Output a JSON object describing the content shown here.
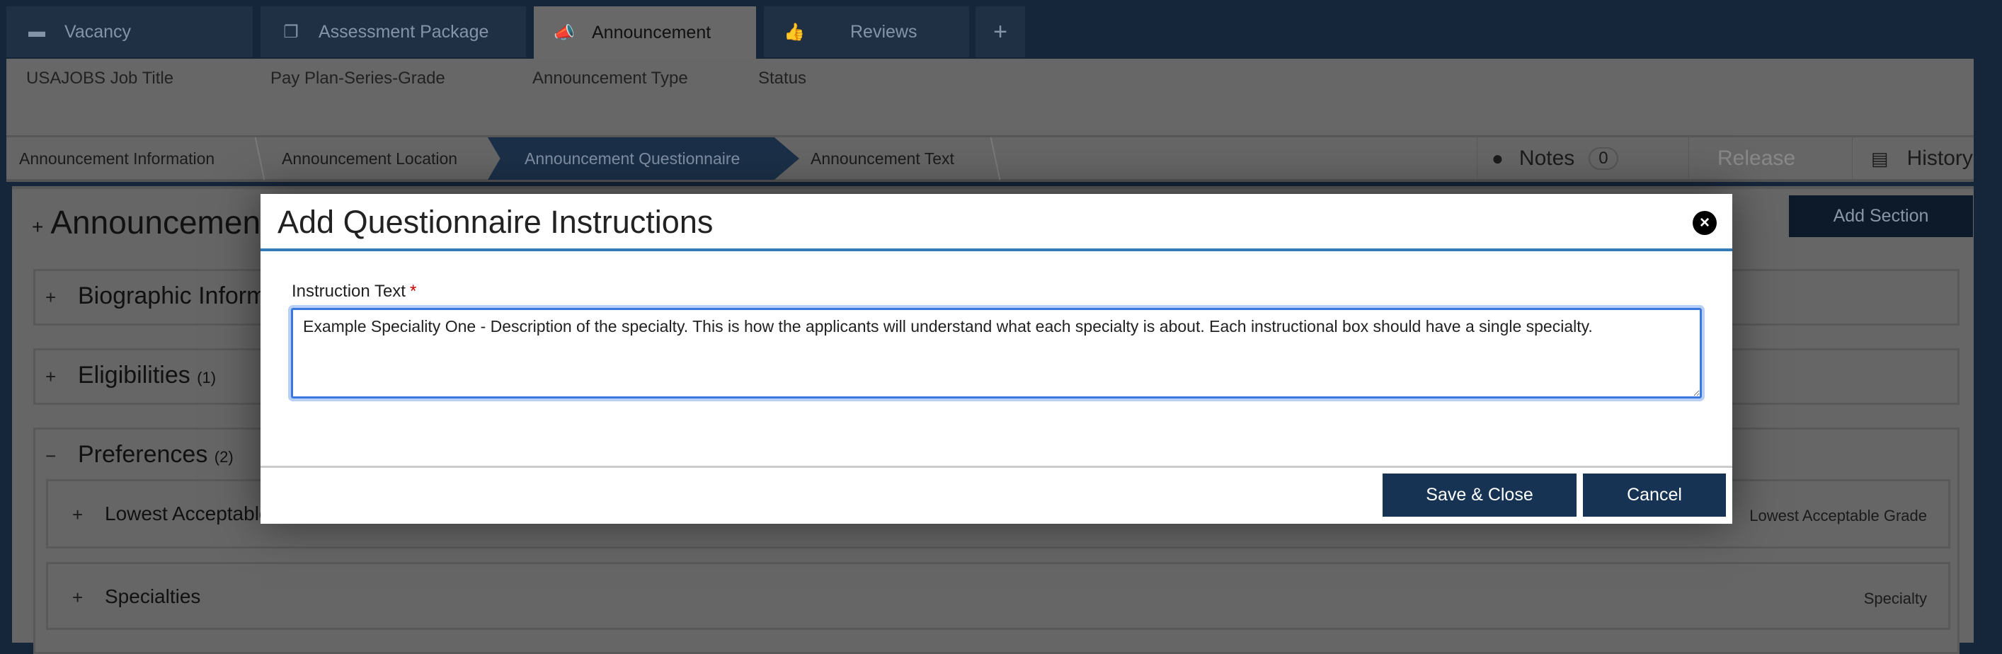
{
  "tabs": [
    {
      "label": "Vacancy",
      "icon": "folder-icon"
    },
    {
      "label": "Assessment Package",
      "icon": "copy-icon"
    },
    {
      "label": "Announcement",
      "icon": "bullhorn-icon"
    },
    {
      "label": "Reviews",
      "icon": "thumbs-up-icon"
    },
    {
      "label": "+",
      "icon": "plus-icon"
    }
  ],
  "info": {
    "job_title": "USAJOBS Job Title",
    "pay_plan": "Pay Plan-Series-Grade",
    "type": "Announcement Type",
    "status": "Status"
  },
  "steps": [
    "Announcement Information",
    "Announcement Location",
    "Announcement Questionnaire",
    "Announcement Text"
  ],
  "tools": {
    "notes": "Notes",
    "notes_count": "0",
    "release": "Release",
    "history": "History"
  },
  "page": {
    "title": "Announcement",
    "add_section": "Add Section"
  },
  "sections": [
    {
      "sign": "+",
      "label": "Biographic Information",
      "count": ""
    },
    {
      "sign": "+",
      "label": "Eligibilities",
      "count": "(1)"
    },
    {
      "sign": "−",
      "label": "Preferences",
      "count": "(2)"
    }
  ],
  "subsections": [
    {
      "sign": "+",
      "label": "Lowest Acceptable Grade",
      "right": "Lowest Acceptable Grade"
    },
    {
      "sign": "+",
      "label": "Specialties",
      "right": "Specialty"
    }
  ],
  "modal": {
    "title": "Add Questionnaire Instructions",
    "close": "×",
    "field_label": "Instruction Text",
    "required": "*",
    "value": "Example Speciality One - Description of the specialty. This is how the applicants will understand what each specialty is about. Each instructional box should have a single specialty.",
    "save": "Save & Close",
    "cancel": "Cancel"
  }
}
